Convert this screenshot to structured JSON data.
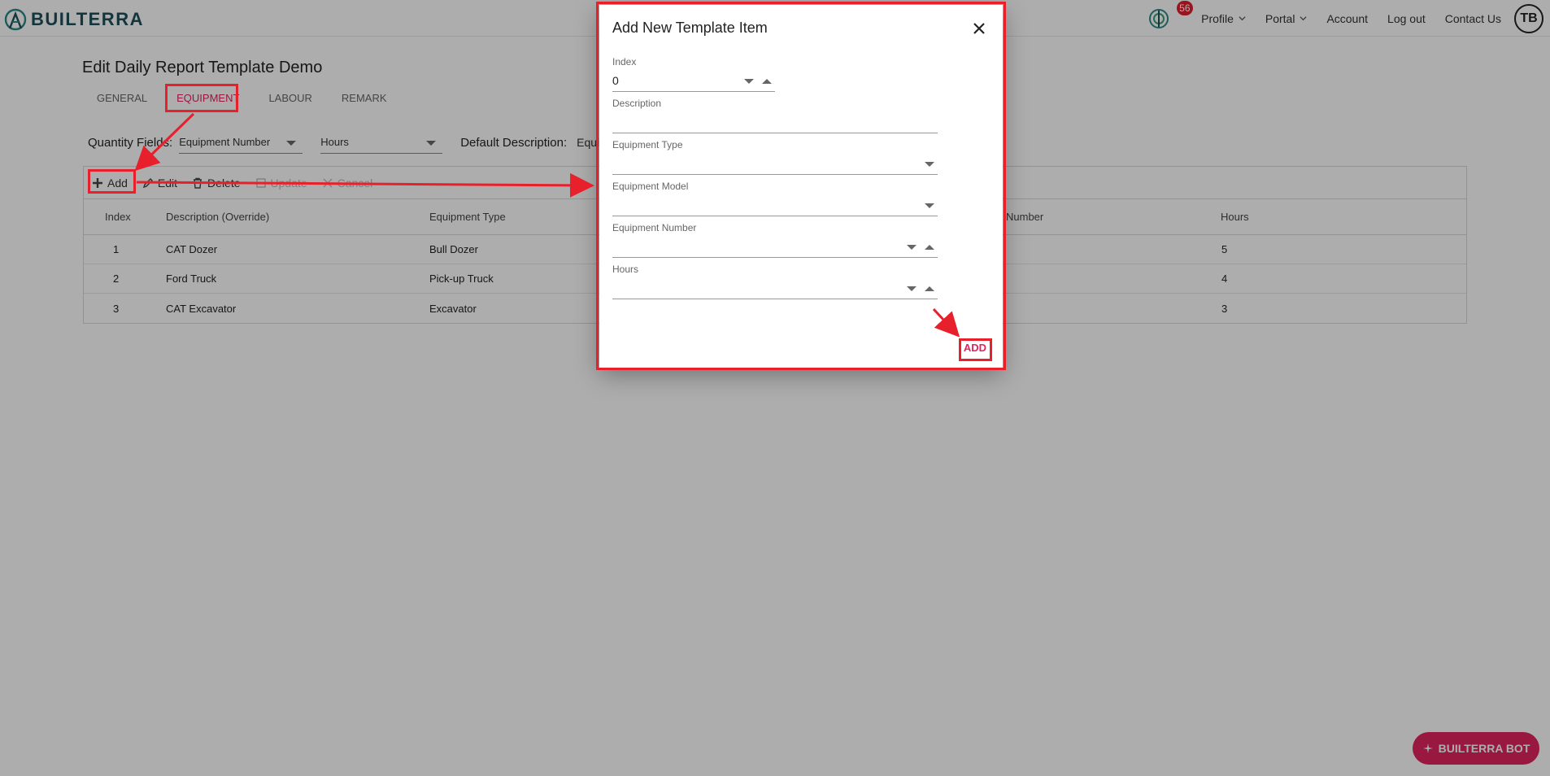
{
  "header": {
    "logo_text": "BUILTERRA",
    "notification_count": "56",
    "nav": {
      "profile": "Profile",
      "portal": "Portal",
      "account": "Account",
      "logout": "Log out",
      "contact": "Contact Us"
    },
    "avatar_initials": "TB"
  },
  "page": {
    "title": "Edit Daily Report Template Demo",
    "tabs": [
      {
        "label": "GENERAL",
        "active": false
      },
      {
        "label": "EQUIPMENT",
        "active": true
      },
      {
        "label": "LABOUR",
        "active": false
      },
      {
        "label": "REMARK",
        "active": false
      }
    ],
    "quantity_fields_label": "Quantity Fields:",
    "quantity_field_1": "Equipment Number",
    "quantity_field_2": "Hours",
    "default_description_label": "Default Description:",
    "default_description_value": "Equipme"
  },
  "toolbar": {
    "add": "Add",
    "edit": "Edit",
    "delete": "Delete",
    "update": "Update",
    "cancel": "Cancel"
  },
  "grid": {
    "columns": [
      "Index",
      "Description (Override)",
      "Equipment Type",
      "Number",
      "Hours"
    ],
    "rows": [
      {
        "index": "1",
        "description": "CAT Dozer",
        "type": "Bull Dozer",
        "hours": "5"
      },
      {
        "index": "2",
        "description": "Ford Truck",
        "type": "Pick-up Truck",
        "hours": "4"
      },
      {
        "index": "3",
        "description": "CAT Excavator",
        "type": "Excavator",
        "hours": "3"
      }
    ]
  },
  "dialog": {
    "title": "Add New Template Item",
    "index_label": "Index",
    "index_value": "0",
    "description_label": "Description",
    "equipment_type_label": "Equipment Type",
    "equipment_model_label": "Equipment Model",
    "equipment_number_label": "Equipment Number",
    "hours_label": "Hours",
    "add_button": "ADD"
  },
  "bot_button": "BUILTERRA BOT",
  "colors": {
    "accent": "#e0245e",
    "annotation": "#e8202b",
    "logo": "#1f4f5a"
  }
}
